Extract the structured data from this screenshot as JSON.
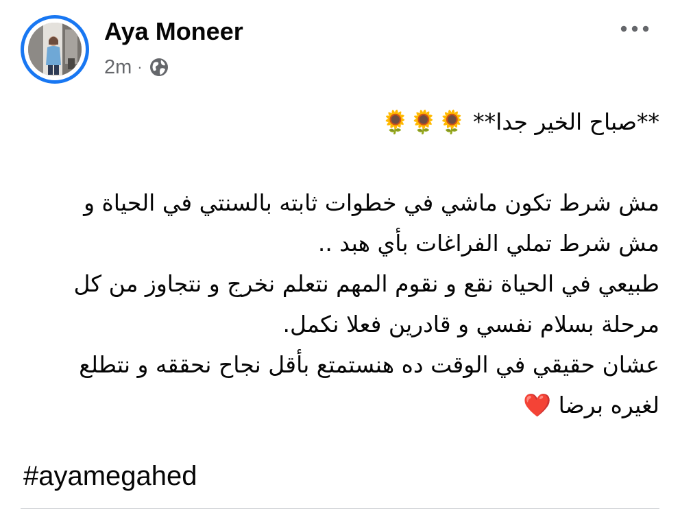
{
  "post": {
    "author_name": "Aya Moneer",
    "timestamp": "2m",
    "separator": "·",
    "audience_icon": "globe-icon",
    "more_icon": "more-options-icon",
    "lines": [
      "**صباح الخير جدا** 🌻🌻🌻",
      "",
      "مش شرط تكون ماشي في خطوات ثابته بالسنتي في الحياة و",
      "مش شرط تملي الفراغات بأي هبد ..",
      "طبيعي في الحياة نقع و نقوم المهم نتعلم نخرج و نتجاوز من كل",
      "مرحلة بسلام نفسي و قادرين فعلا نكمل.",
      "عشان حقيقي في الوقت ده هنستمتع بأقل نجاح نحققه و نتطلع",
      "لغيره برضا ❤️"
    ],
    "hashtag": "#ayamegahed"
  },
  "colors": {
    "accent_ring": "#1877f2",
    "secondary_text": "#65676b",
    "primary_text": "#050505"
  }
}
